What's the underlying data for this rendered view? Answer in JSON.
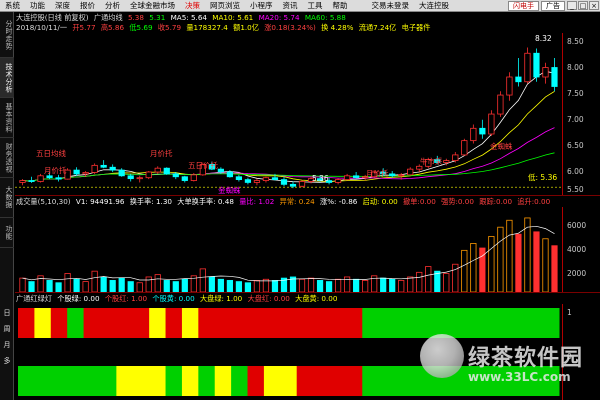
{
  "menu": [
    "系统",
    "功能",
    "深度",
    "报价",
    "分析",
    "全球金融市场",
    "决策",
    "网页浏览",
    "小程序",
    "资讯",
    "工具",
    "帮助"
  ],
  "menu_active_index": 6,
  "login_status": "交易未登录",
  "app_name": "大连控股",
  "quick_btn": "闪电手",
  "ad_btn": "广告",
  "left_tabs": [
    "分时走势",
    "技术分析",
    "基本资料",
    "财务透视",
    "大数据",
    "功能"
  ],
  "weekdays": [
    "日",
    "周",
    "月",
    "多"
  ],
  "main_info": {
    "stock": "大连控股(日线 前复权)",
    "indicator": "广通均线",
    "v1": "5.38",
    "v2": "5.31",
    "ma5": "MA5: 5.64",
    "ma10": "MA10: 5.61",
    "ma20": "MA20: 5.74",
    "ma60": "MA60: 5.88"
  },
  "sub_info": {
    "date": "2018/10/11/一",
    "open": "开5.77",
    "high": "高5.86",
    "low": "低5.69",
    "close": "收5.79",
    "vol": "量178327.4",
    "amt": "额1.0亿",
    "chg": "涨0.18(3.24%)",
    "turn": "换 4.28%",
    "cap": "流通7.24亿",
    "tag": "电子器件"
  },
  "price_axis": [
    "8.50",
    "8.00",
    "7.50",
    "7.00",
    "6.50",
    "6.00",
    "5.50"
  ],
  "annotations": {
    "high_price": "8.32",
    "low_price": "5.36",
    "bottom_price": "低: 5.36",
    "labels": [
      "五日均线",
      "月价托",
      "月价托",
      "五日价托",
      "牛市采",
      "月价托",
      "金蜘蛛",
      "金蜘蛛",
      "底"
    ]
  },
  "vol_info": {
    "name": "成交量(5,10,30)",
    "v1": "V1: 94491.96",
    "hs": "换手率: 1.30",
    "big": "大单换手率: 0.48",
    "r1": "量比: 1.02",
    "r2": "异常: 0.24",
    "zz": "涨%: -0.86",
    "qd": "启动: 0.00",
    "sl": "撤单:0.00",
    "bd": "强势:0.00",
    "jd": "跟踪:0.00",
    "yt": "追升:0.00"
  },
  "vol_axis": [
    "6000",
    "4000",
    "2000"
  ],
  "band_info": {
    "name": "广通红绿灯",
    "a": "个股绿: 0.00",
    "b": "个股红: 1.00",
    "c": "个股黄: 0.00",
    "d": "大盘绿: 1.00",
    "e": "大盘红: 0.00",
    "f": "大盘黄: 0.00"
  },
  "band_axis": [
    "1",
    "0"
  ],
  "watermark": {
    "text": "绿茶软件园",
    "url": "www.33LC.com"
  },
  "colors": {
    "red": "#e00000",
    "green": "#00d000",
    "yellow": "#ffff00",
    "cyan": "#00ffff",
    "magenta": "#ff00ff",
    "orange": "#ff9900",
    "bg": "#000000"
  },
  "chart_data": {
    "type": "candlestick",
    "price_range": [
      5.3,
      8.5
    ],
    "candles": [
      [
        5.48,
        5.55,
        5.42,
        5.52
      ],
      [
        5.52,
        5.6,
        5.47,
        5.5
      ],
      [
        5.5,
        5.66,
        5.48,
        5.62
      ],
      [
        5.62,
        5.7,
        5.55,
        5.58
      ],
      [
        5.58,
        5.64,
        5.5,
        5.55
      ],
      [
        5.55,
        5.78,
        5.54,
        5.74
      ],
      [
        5.74,
        5.8,
        5.62,
        5.66
      ],
      [
        5.66,
        5.72,
        5.6,
        5.69
      ],
      [
        5.69,
        5.88,
        5.66,
        5.84
      ],
      [
        5.84,
        5.95,
        5.78,
        5.8
      ],
      [
        5.8,
        5.86,
        5.7,
        5.74
      ],
      [
        5.74,
        5.78,
        5.6,
        5.62
      ],
      [
        5.62,
        5.66,
        5.5,
        5.56
      ],
      [
        5.56,
        5.62,
        5.48,
        5.58
      ],
      [
        5.58,
        5.72,
        5.55,
        5.7
      ],
      [
        5.7,
        5.82,
        5.66,
        5.78
      ],
      [
        5.78,
        5.8,
        5.64,
        5.66
      ],
      [
        5.66,
        5.7,
        5.55,
        5.6
      ],
      [
        5.6,
        5.62,
        5.48,
        5.52
      ],
      [
        5.52,
        5.68,
        5.5,
        5.64
      ],
      [
        5.64,
        5.9,
        5.62,
        5.86
      ],
      [
        5.86,
        5.92,
        5.74,
        5.76
      ],
      [
        5.76,
        5.8,
        5.66,
        5.7
      ],
      [
        5.7,
        5.74,
        5.58,
        5.6
      ],
      [
        5.6,
        5.64,
        5.5,
        5.54
      ],
      [
        5.54,
        5.58,
        5.44,
        5.48
      ],
      [
        5.48,
        5.56,
        5.42,
        5.52
      ],
      [
        5.52,
        5.6,
        5.48,
        5.58
      ],
      [
        5.58,
        5.66,
        5.52,
        5.54
      ],
      [
        5.54,
        5.6,
        5.4,
        5.44
      ],
      [
        5.44,
        5.5,
        5.36,
        5.4
      ],
      [
        5.4,
        5.52,
        5.38,
        5.5
      ],
      [
        5.5,
        5.6,
        5.46,
        5.56
      ],
      [
        5.56,
        5.62,
        5.5,
        5.52
      ],
      [
        5.52,
        5.58,
        5.44,
        5.48
      ],
      [
        5.48,
        5.56,
        5.44,
        5.54
      ],
      [
        5.54,
        5.66,
        5.52,
        5.62
      ],
      [
        5.62,
        5.7,
        5.56,
        5.58
      ],
      [
        5.58,
        5.64,
        5.52,
        5.6
      ],
      [
        5.6,
        5.74,
        5.58,
        5.7
      ],
      [
        5.7,
        5.78,
        5.62,
        5.66
      ],
      [
        5.66,
        5.72,
        5.58,
        5.62
      ],
      [
        5.62,
        5.68,
        5.54,
        5.64
      ],
      [
        5.64,
        5.8,
        5.62,
        5.76
      ],
      [
        5.76,
        5.86,
        5.7,
        5.82
      ],
      [
        5.82,
        6.0,
        5.78,
        5.96
      ],
      [
        5.96,
        6.04,
        5.86,
        5.9
      ],
      [
        5.9,
        5.98,
        5.84,
        5.94
      ],
      [
        5.94,
        6.12,
        5.9,
        6.06
      ],
      [
        6.06,
        6.4,
        6.04,
        6.36
      ],
      [
        6.36,
        6.7,
        6.3,
        6.62
      ],
      [
        6.62,
        6.8,
        6.4,
        6.5
      ],
      [
        6.5,
        7.0,
        6.46,
        6.92
      ],
      [
        6.92,
        7.4,
        6.86,
        7.32
      ],
      [
        7.32,
        7.8,
        7.2,
        7.7
      ],
      [
        7.7,
        8.1,
        7.5,
        7.6
      ],
      [
        7.6,
        8.32,
        7.56,
        8.2
      ],
      [
        8.2,
        8.3,
        7.6,
        7.7
      ],
      [
        7.7,
        8.0,
        7.56,
        7.9
      ],
      [
        7.9,
        8.1,
        7.4,
        7.5
      ]
    ],
    "volume": [
      1200,
      900,
      1400,
      1000,
      800,
      1600,
      1100,
      900,
      1800,
      1300,
      1000,
      1200,
      900,
      800,
      1300,
      1500,
      1000,
      900,
      1100,
      1400,
      2000,
      1300,
      1100,
      1000,
      900,
      800,
      1000,
      1100,
      1000,
      1200,
      1300,
      1100,
      1200,
      1000,
      900,
      1100,
      1300,
      1100,
      1000,
      1400,
      1200,
      1100,
      1000,
      1300,
      1700,
      2200,
      1800,
      1600,
      2400,
      3600,
      4200,
      3800,
      4800,
      5600,
      6200,
      5000,
      6400,
      5200,
      4600,
      4000
    ],
    "band1": [
      "r",
      "y",
      "r",
      "g",
      "r",
      "r",
      "r",
      "r",
      "y",
      "r",
      "y",
      "r",
      "r",
      "r",
      "r",
      "r",
      "r",
      "r",
      "r",
      "r",
      "r",
      "g",
      "g",
      "g",
      "g",
      "g",
      "g",
      "g",
      "g",
      "g",
      "g",
      "g",
      "g"
    ],
    "band2": [
      "g",
      "g",
      "g",
      "g",
      "g",
      "g",
      "y",
      "y",
      "y",
      "g",
      "y",
      "g",
      "y",
      "g",
      "r",
      "y",
      "y",
      "r",
      "r",
      "r",
      "r",
      "g",
      "g",
      "g",
      "g",
      "g",
      "g",
      "g",
      "g",
      "g",
      "g",
      "g",
      "g"
    ]
  }
}
